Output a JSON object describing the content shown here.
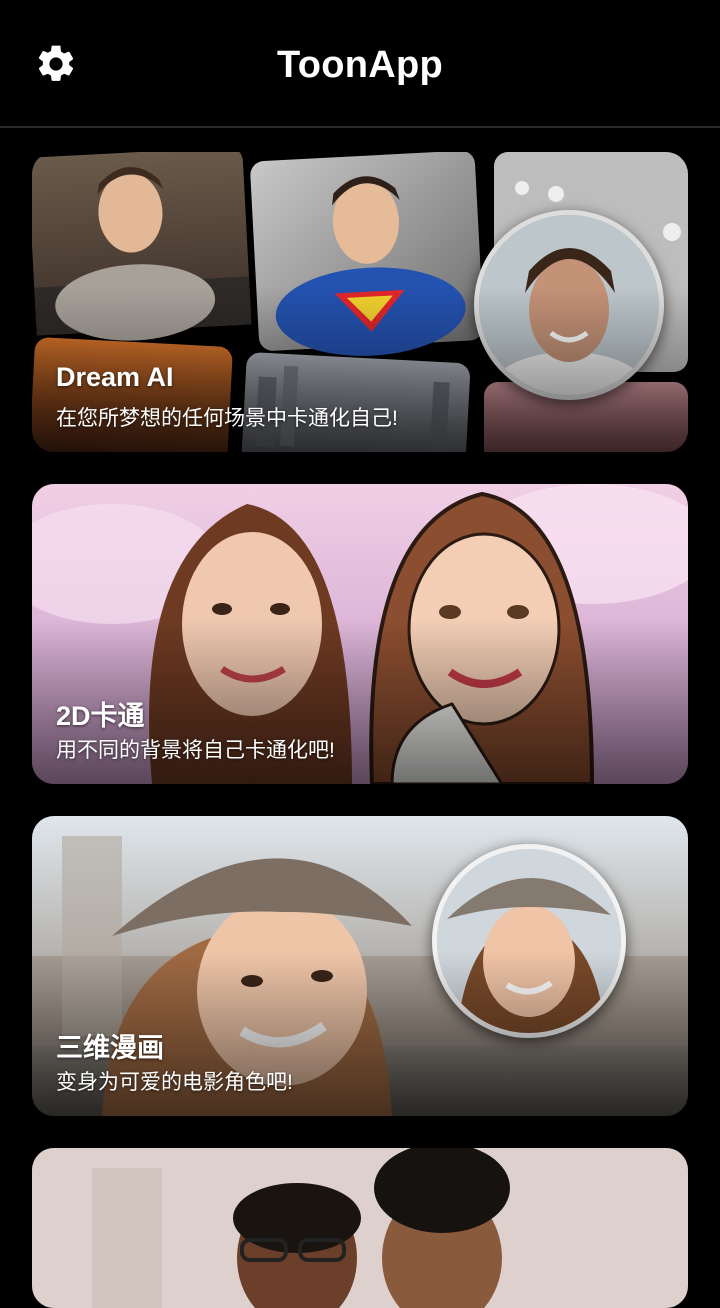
{
  "app": {
    "title": "ToonApp"
  },
  "header": {
    "settings_icon": "gear-icon"
  },
  "cards": [
    {
      "title": "Dream AI",
      "subtitle": "在您所梦想的任何场景中卡通化自己!"
    },
    {
      "title": "2D卡通",
      "subtitle": "用不同的背景将自己卡通化吧!"
    },
    {
      "title": "三维漫画",
      "subtitle": "变身为可爱的电影角色吧!"
    },
    {
      "title": "",
      "subtitle": ""
    }
  ],
  "colors": {
    "background": "#000000",
    "text": "#ffffff",
    "divider": "#2a2a2a",
    "card2_tint": "#e7b7d9",
    "card3_tint": "#bfc4c8"
  }
}
